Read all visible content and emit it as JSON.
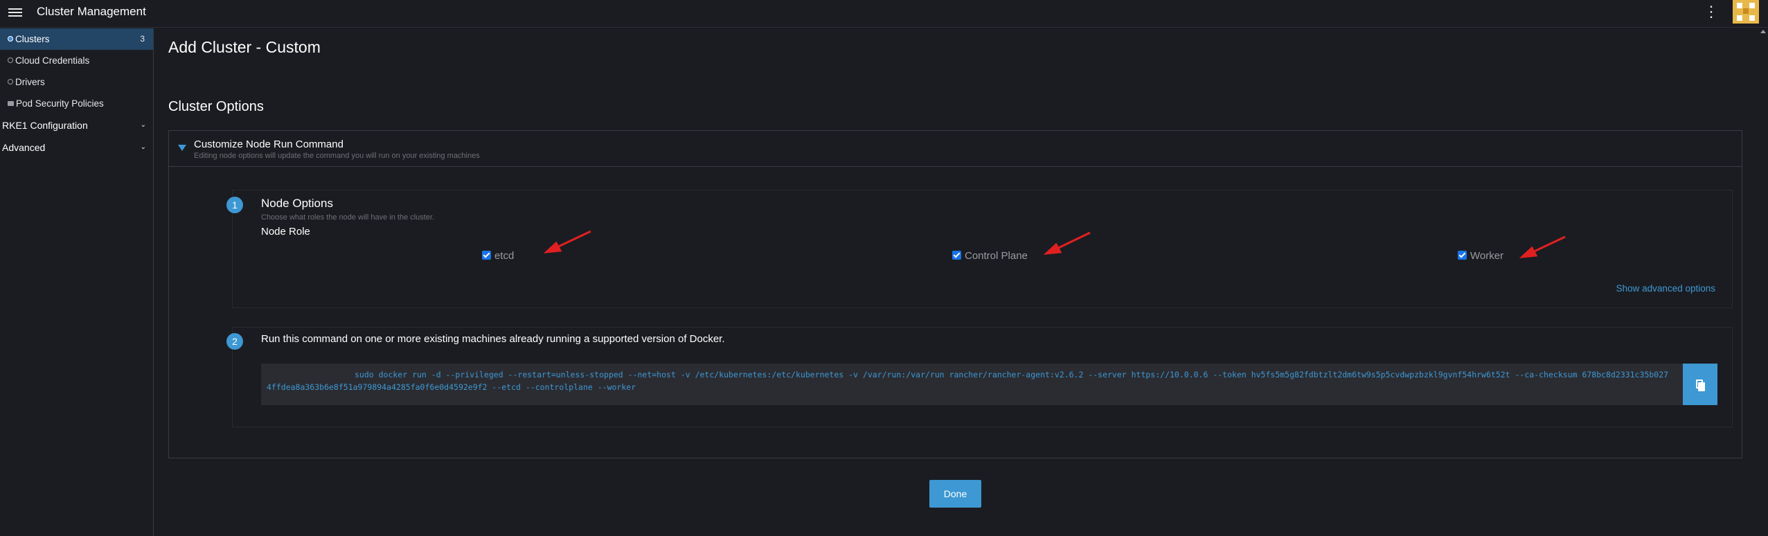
{
  "header": {
    "app_title": "Cluster Management",
    "menu_icon": "hamburger-icon",
    "more_icon": "kebab-icon"
  },
  "sidebar": {
    "items": [
      {
        "label": "Clusters",
        "count": "3",
        "active": true,
        "icon": "globe-icon"
      },
      {
        "label": "Cloud Credentials",
        "icon": "globe-icon"
      },
      {
        "label": "Drivers",
        "icon": "globe-icon"
      },
      {
        "label": "Pod Security Policies",
        "icon": "folder-icon"
      }
    ],
    "groups": [
      {
        "label": "RKE1 Configuration",
        "icon": "chevron-down-icon"
      },
      {
        "label": "Advanced",
        "icon": "chevron-down-icon"
      }
    ]
  },
  "main": {
    "page_title": "Add Cluster - Custom",
    "section_title": "Cluster Options",
    "accordion": {
      "title": "Customize Node Run Command",
      "subtitle": "Editing node options will update the command you will run on your existing machines"
    },
    "step1": {
      "number": "1",
      "title": "Node Options",
      "subtitle": "Choose what roles the node will have in the cluster.",
      "role_label": "Node Role",
      "roles": [
        {
          "label": "etcd",
          "checked": true
        },
        {
          "label": "Control Plane",
          "checked": true
        },
        {
          "label": "Worker",
          "checked": true
        }
      ],
      "advanced_link": "Show advanced options"
    },
    "step2": {
      "number": "2",
      "title": "Run this command on one or more existing machines already running a supported version of Docker.",
      "command": "sudo docker run -d --privileged --restart=unless-stopped --net=host -v /etc/kubernetes:/etc/kubernetes -v /var/run:/var/run  rancher/rancher-agent:v2.6.2 --server https://10.0.0.6 --token hv5fs5m5g82fdbtzlt2dm6tw9s5p5cvdwpzbzkl9gvnf54hrw6t52t --ca-checksum 678bc8d2331c35b0274ffdea8a363b6e8f51a979894a4285fa0f6e0d4592e9f2 --etcd --controlplane --worker"
    },
    "done_label": "Done"
  },
  "colors": {
    "accent": "#3d98d3",
    "active_nav": "#234566",
    "background": "#1b1c21",
    "annotation_arrow": "#e02020"
  }
}
